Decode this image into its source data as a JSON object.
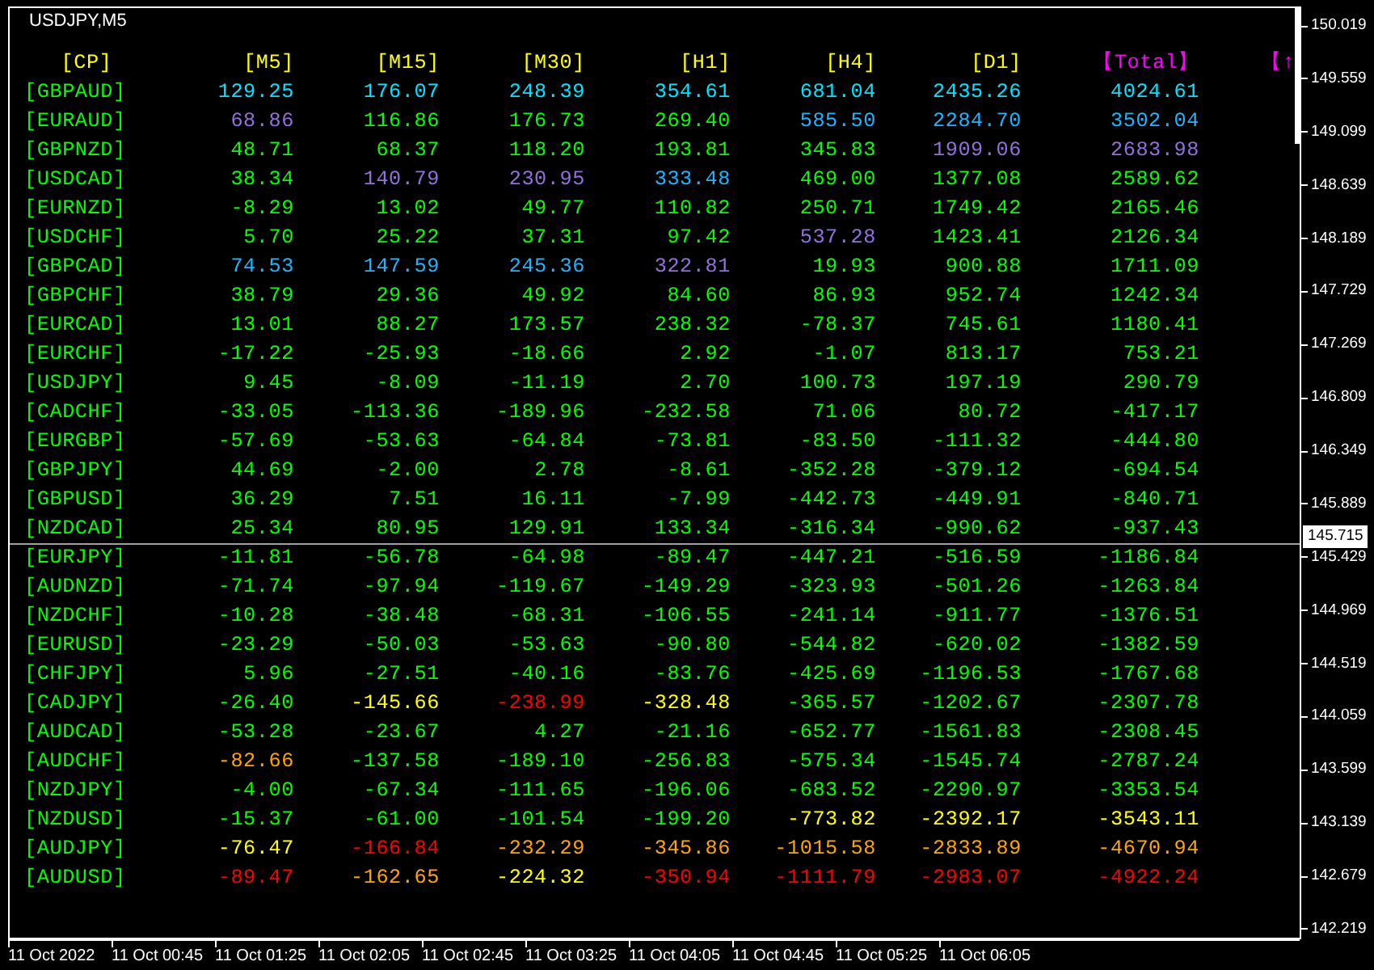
{
  "chart": {
    "title": "USDJPY,M5",
    "columns": [
      {
        "label": "[CP]",
        "color": "#ffff00"
      },
      {
        "label": "[M5]",
        "color": "#ffff00"
      },
      {
        "label": "[M15]",
        "color": "#ffff00"
      },
      {
        "label": "[M30]",
        "color": "#ffff00"
      },
      {
        "label": "[H1]",
        "color": "#ffff00"
      },
      {
        "label": "[H4]",
        "color": "#ffff00"
      },
      {
        "label": "[D1]",
        "color": "#ffff00"
      },
      {
        "label": "【Total】",
        "color": "#ff00ff"
      },
      {
        "label": "【↑",
        "color": "#ff00ff"
      }
    ],
    "rows": [
      {
        "cells": [
          {
            "value": "[GBPAUD]",
            "color": "#00ff00"
          },
          {
            "value": "129.25",
            "color": "#00e5ff"
          },
          {
            "value": "176.07",
            "color": "#00e5ff"
          },
          {
            "value": "248.39",
            "color": "#00e5ff"
          },
          {
            "value": "354.61",
            "color": "#00e5ff"
          },
          {
            "value": "681.04",
            "color": "#00e5ff"
          },
          {
            "value": "2435.26",
            "color": "#00e5ff"
          },
          {
            "value": "4024.61",
            "color": "#00e5ff"
          }
        ]
      },
      {
        "cells": [
          {
            "value": "[EURAUD]",
            "color": "#00ff00"
          },
          {
            "value": "68.86",
            "color": "#9370db"
          },
          {
            "value": "116.86",
            "color": "#00ff00"
          },
          {
            "value": "176.73",
            "color": "#00ff00"
          },
          {
            "value": "269.40",
            "color": "#00ff00"
          },
          {
            "value": "585.50",
            "color": "#1eb4ff"
          },
          {
            "value": "2284.70",
            "color": "#1eb4ff"
          },
          {
            "value": "3502.04",
            "color": "#1eb4ff"
          }
        ]
      },
      {
        "cells": [
          {
            "value": "[GBPNZD]",
            "color": "#00ff00"
          },
          {
            "value": "48.71",
            "color": "#00ff00"
          },
          {
            "value": "68.37",
            "color": "#00ff00"
          },
          {
            "value": "118.20",
            "color": "#00ff00"
          },
          {
            "value": "193.81",
            "color": "#00ff00"
          },
          {
            "value": "345.83",
            "color": "#00ff00"
          },
          {
            "value": "1909.06",
            "color": "#9370db"
          },
          {
            "value": "2683.98",
            "color": "#9370db"
          }
        ]
      },
      {
        "cells": [
          {
            "value": "[USDCAD]",
            "color": "#00ff00"
          },
          {
            "value": "38.34",
            "color": "#00ff00"
          },
          {
            "value": "140.79",
            "color": "#9370db"
          },
          {
            "value": "230.95",
            "color": "#9370db"
          },
          {
            "value": "333.48",
            "color": "#1eb4ff"
          },
          {
            "value": "469.00",
            "color": "#00ff00"
          },
          {
            "value": "1377.08",
            "color": "#00ff00"
          },
          {
            "value": "2589.62",
            "color": "#00ff00"
          }
        ]
      },
      {
        "cells": [
          {
            "value": "[EURNZD]",
            "color": "#00ff00"
          },
          {
            "value": "-8.29",
            "color": "#00ff00"
          },
          {
            "value": "13.02",
            "color": "#00ff00"
          },
          {
            "value": "49.77",
            "color": "#00ff00"
          },
          {
            "value": "110.82",
            "color": "#00ff00"
          },
          {
            "value": "250.71",
            "color": "#00ff00"
          },
          {
            "value": "1749.42",
            "color": "#00ff00"
          },
          {
            "value": "2165.46",
            "color": "#00ff00"
          }
        ]
      },
      {
        "cells": [
          {
            "value": "[USDCHF]",
            "color": "#00ff00"
          },
          {
            "value": "5.70",
            "color": "#00ff00"
          },
          {
            "value": "25.22",
            "color": "#00ff00"
          },
          {
            "value": "37.31",
            "color": "#00ff00"
          },
          {
            "value": "97.42",
            "color": "#00ff00"
          },
          {
            "value": "537.28",
            "color": "#9370db"
          },
          {
            "value": "1423.41",
            "color": "#00ff00"
          },
          {
            "value": "2126.34",
            "color": "#00ff00"
          }
        ]
      },
      {
        "cells": [
          {
            "value": "[GBPCAD]",
            "color": "#00ff00"
          },
          {
            "value": "74.53",
            "color": "#1eb4ff"
          },
          {
            "value": "147.59",
            "color": "#1eb4ff"
          },
          {
            "value": "245.36",
            "color": "#1eb4ff"
          },
          {
            "value": "322.81",
            "color": "#9370db"
          },
          {
            "value": "19.93",
            "color": "#00ff00"
          },
          {
            "value": "900.88",
            "color": "#00ff00"
          },
          {
            "value": "1711.09",
            "color": "#00ff00"
          }
        ]
      },
      {
        "cells": [
          {
            "value": "[GBPCHF]",
            "color": "#00ff00"
          },
          {
            "value": "38.79",
            "color": "#00ff00"
          },
          {
            "value": "29.36",
            "color": "#00ff00"
          },
          {
            "value": "49.92",
            "color": "#00ff00"
          },
          {
            "value": "84.60",
            "color": "#00ff00"
          },
          {
            "value": "86.93",
            "color": "#00ff00"
          },
          {
            "value": "952.74",
            "color": "#00ff00"
          },
          {
            "value": "1242.34",
            "color": "#00ff00"
          }
        ]
      },
      {
        "cells": [
          {
            "value": "[EURCAD]",
            "color": "#00ff00"
          },
          {
            "value": "13.01",
            "color": "#00ff00"
          },
          {
            "value": "88.27",
            "color": "#00ff00"
          },
          {
            "value": "173.57",
            "color": "#00ff00"
          },
          {
            "value": "238.32",
            "color": "#00ff00"
          },
          {
            "value": "-78.37",
            "color": "#00ff00"
          },
          {
            "value": "745.61",
            "color": "#00ff00"
          },
          {
            "value": "1180.41",
            "color": "#00ff00"
          }
        ]
      },
      {
        "cells": [
          {
            "value": "[EURCHF]",
            "color": "#00ff00"
          },
          {
            "value": "-17.22",
            "color": "#00ff00"
          },
          {
            "value": "-25.93",
            "color": "#00ff00"
          },
          {
            "value": "-18.66",
            "color": "#00ff00"
          },
          {
            "value": "2.92",
            "color": "#00ff00"
          },
          {
            "value": "-1.07",
            "color": "#00ff00"
          },
          {
            "value": "813.17",
            "color": "#00ff00"
          },
          {
            "value": "753.21",
            "color": "#00ff00"
          }
        ]
      },
      {
        "cells": [
          {
            "value": "[USDJPY]",
            "color": "#00ff00"
          },
          {
            "value": "9.45",
            "color": "#00ff00"
          },
          {
            "value": "-8.09",
            "color": "#00ff00"
          },
          {
            "value": "-11.19",
            "color": "#00ff00"
          },
          {
            "value": "2.70",
            "color": "#00ff00"
          },
          {
            "value": "100.73",
            "color": "#00ff00"
          },
          {
            "value": "197.19",
            "color": "#00ff00"
          },
          {
            "value": "290.79",
            "color": "#00ff00"
          }
        ]
      },
      {
        "cells": [
          {
            "value": "[CADCHF]",
            "color": "#00ff00"
          },
          {
            "value": "-33.05",
            "color": "#00ff00"
          },
          {
            "value": "-113.36",
            "color": "#00ff00"
          },
          {
            "value": "-189.96",
            "color": "#00ff00"
          },
          {
            "value": "-232.58",
            "color": "#00ff00"
          },
          {
            "value": "71.06",
            "color": "#00ff00"
          },
          {
            "value": "80.72",
            "color": "#00ff00"
          },
          {
            "value": "-417.17",
            "color": "#00ff00"
          }
        ]
      },
      {
        "cells": [
          {
            "value": "[EURGBP]",
            "color": "#00ff00"
          },
          {
            "value": "-57.69",
            "color": "#00ff00"
          },
          {
            "value": "-53.63",
            "color": "#00ff00"
          },
          {
            "value": "-64.84",
            "color": "#00ff00"
          },
          {
            "value": "-73.81",
            "color": "#00ff00"
          },
          {
            "value": "-83.50",
            "color": "#00ff00"
          },
          {
            "value": "-111.32",
            "color": "#00ff00"
          },
          {
            "value": "-444.80",
            "color": "#00ff00"
          }
        ]
      },
      {
        "cells": [
          {
            "value": "[GBPJPY]",
            "color": "#00ff00"
          },
          {
            "value": "44.69",
            "color": "#00ff00"
          },
          {
            "value": "-2.00",
            "color": "#00ff00"
          },
          {
            "value": "2.78",
            "color": "#00ff00"
          },
          {
            "value": "-8.61",
            "color": "#00ff00"
          },
          {
            "value": "-352.28",
            "color": "#00ff00"
          },
          {
            "value": "-379.12",
            "color": "#00ff00"
          },
          {
            "value": "-694.54",
            "color": "#00ff00"
          }
        ]
      },
      {
        "cells": [
          {
            "value": "[GBPUSD]",
            "color": "#00ff00"
          },
          {
            "value": "36.29",
            "color": "#00ff00"
          },
          {
            "value": "7.51",
            "color": "#00ff00"
          },
          {
            "value": "16.11",
            "color": "#00ff00"
          },
          {
            "value": "-7.99",
            "color": "#00ff00"
          },
          {
            "value": "-442.73",
            "color": "#00ff00"
          },
          {
            "value": "-449.91",
            "color": "#00ff00"
          },
          {
            "value": "-840.71",
            "color": "#00ff00"
          }
        ]
      },
      {
        "cells": [
          {
            "value": "[NZDCAD]",
            "color": "#00ff00"
          },
          {
            "value": "25.34",
            "color": "#00ff00"
          },
          {
            "value": "80.95",
            "color": "#00ff00"
          },
          {
            "value": "129.91",
            "color": "#00ff00"
          },
          {
            "value": "133.34",
            "color": "#00ff00"
          },
          {
            "value": "-316.34",
            "color": "#00ff00"
          },
          {
            "value": "-990.62",
            "color": "#00ff00"
          },
          {
            "value": "-937.43",
            "color": "#00ff00"
          }
        ]
      },
      {
        "cells": [
          {
            "value": "[EURJPY]",
            "color": "#00ff00"
          },
          {
            "value": "-11.81",
            "color": "#00ff00"
          },
          {
            "value": "-56.78",
            "color": "#00ff00"
          },
          {
            "value": "-64.98",
            "color": "#00ff00"
          },
          {
            "value": "-89.47",
            "color": "#00ff00"
          },
          {
            "value": "-447.21",
            "color": "#00ff00"
          },
          {
            "value": "-516.59",
            "color": "#00ff00"
          },
          {
            "value": "-1186.84",
            "color": "#00ff00"
          }
        ]
      },
      {
        "cells": [
          {
            "value": "[AUDNZD]",
            "color": "#00ff00"
          },
          {
            "value": "-71.74",
            "color": "#00ff00"
          },
          {
            "value": "-97.94",
            "color": "#00ff00"
          },
          {
            "value": "-119.67",
            "color": "#00ff00"
          },
          {
            "value": "-149.29",
            "color": "#00ff00"
          },
          {
            "value": "-323.93",
            "color": "#00ff00"
          },
          {
            "value": "-501.26",
            "color": "#00ff00"
          },
          {
            "value": "-1263.84",
            "color": "#00ff00"
          }
        ]
      },
      {
        "cells": [
          {
            "value": "[NZDCHF]",
            "color": "#00ff00"
          },
          {
            "value": "-10.28",
            "color": "#00ff00"
          },
          {
            "value": "-38.48",
            "color": "#00ff00"
          },
          {
            "value": "-68.31",
            "color": "#00ff00"
          },
          {
            "value": "-106.55",
            "color": "#00ff00"
          },
          {
            "value": "-241.14",
            "color": "#00ff00"
          },
          {
            "value": "-911.77",
            "color": "#00ff00"
          },
          {
            "value": "-1376.51",
            "color": "#00ff00"
          }
        ]
      },
      {
        "cells": [
          {
            "value": "[EURUSD]",
            "color": "#00ff00"
          },
          {
            "value": "-23.29",
            "color": "#00ff00"
          },
          {
            "value": "-50.03",
            "color": "#00ff00"
          },
          {
            "value": "-53.63",
            "color": "#00ff00"
          },
          {
            "value": "-90.80",
            "color": "#00ff00"
          },
          {
            "value": "-544.82",
            "color": "#00ff00"
          },
          {
            "value": "-620.02",
            "color": "#00ff00"
          },
          {
            "value": "-1382.59",
            "color": "#00ff00"
          }
        ]
      },
      {
        "cells": [
          {
            "value": "[CHFJPY]",
            "color": "#00ff00"
          },
          {
            "value": "5.96",
            "color": "#00ff00"
          },
          {
            "value": "-27.51",
            "color": "#00ff00"
          },
          {
            "value": "-40.16",
            "color": "#00ff00"
          },
          {
            "value": "-83.76",
            "color": "#00ff00"
          },
          {
            "value": "-425.69",
            "color": "#00ff00"
          },
          {
            "value": "-1196.53",
            "color": "#00ff00"
          },
          {
            "value": "-1767.68",
            "color": "#00ff00"
          }
        ]
      },
      {
        "cells": [
          {
            "value": "[CADJPY]",
            "color": "#00ff00"
          },
          {
            "value": "-26.40",
            "color": "#00ff00"
          },
          {
            "value": "-145.66",
            "color": "#ffff00"
          },
          {
            "value": "-238.99",
            "color": "#ff0000"
          },
          {
            "value": "-328.48",
            "color": "#ffff00"
          },
          {
            "value": "-365.57",
            "color": "#00ff00"
          },
          {
            "value": "-1202.67",
            "color": "#00ff00"
          },
          {
            "value": "-2307.78",
            "color": "#00ff00"
          }
        ]
      },
      {
        "cells": [
          {
            "value": "[AUDCAD]",
            "color": "#00ff00"
          },
          {
            "value": "-53.28",
            "color": "#00ff00"
          },
          {
            "value": "-23.67",
            "color": "#00ff00"
          },
          {
            "value": "4.27",
            "color": "#00ff00"
          },
          {
            "value": "-21.16",
            "color": "#00ff00"
          },
          {
            "value": "-652.77",
            "color": "#00ff00"
          },
          {
            "value": "-1561.83",
            "color": "#00ff00"
          },
          {
            "value": "-2308.45",
            "color": "#00ff00"
          }
        ]
      },
      {
        "cells": [
          {
            "value": "[AUDCHF]",
            "color": "#00ff00"
          },
          {
            "value": "-82.66",
            "color": "#ffa500"
          },
          {
            "value": "-137.58",
            "color": "#00ff00"
          },
          {
            "value": "-189.10",
            "color": "#00ff00"
          },
          {
            "value": "-256.83",
            "color": "#00ff00"
          },
          {
            "value": "-575.34",
            "color": "#00ff00"
          },
          {
            "value": "-1545.74",
            "color": "#00ff00"
          },
          {
            "value": "-2787.24",
            "color": "#00ff00"
          }
        ]
      },
      {
        "cells": [
          {
            "value": "[NZDJPY]",
            "color": "#00ff00"
          },
          {
            "value": "-4.00",
            "color": "#00ff00"
          },
          {
            "value": "-67.34",
            "color": "#00ff00"
          },
          {
            "value": "-111.65",
            "color": "#00ff00"
          },
          {
            "value": "-196.06",
            "color": "#00ff00"
          },
          {
            "value": "-683.52",
            "color": "#00ff00"
          },
          {
            "value": "-2290.97",
            "color": "#00ff00"
          },
          {
            "value": "-3353.54",
            "color": "#00ff00"
          }
        ]
      },
      {
        "cells": [
          {
            "value": "[NZDUSD]",
            "color": "#00ff00"
          },
          {
            "value": "-15.37",
            "color": "#00ff00"
          },
          {
            "value": "-61.00",
            "color": "#00ff00"
          },
          {
            "value": "-101.54",
            "color": "#00ff00"
          },
          {
            "value": "-199.20",
            "color": "#00ff00"
          },
          {
            "value": "-773.82",
            "color": "#ffff00"
          },
          {
            "value": "-2392.17",
            "color": "#ffff00"
          },
          {
            "value": "-3543.11",
            "color": "#ffff00"
          }
        ]
      },
      {
        "cells": [
          {
            "value": "[AUDJPY]",
            "color": "#00ff00"
          },
          {
            "value": "-76.47",
            "color": "#ffff00"
          },
          {
            "value": "-166.84",
            "color": "#ff0000"
          },
          {
            "value": "-232.29",
            "color": "#ffa500"
          },
          {
            "value": "-345.86",
            "color": "#ffa500"
          },
          {
            "value": "-1015.58",
            "color": "#ffa500"
          },
          {
            "value": "-2833.89",
            "color": "#ffa500"
          },
          {
            "value": "-4670.94",
            "color": "#ffa500"
          }
        ]
      },
      {
        "cells": [
          {
            "value": "[AUDUSD]",
            "color": "#00ff00"
          },
          {
            "value": "-89.47",
            "color": "#ff0000"
          },
          {
            "value": "-162.65",
            "color": "#ffa500"
          },
          {
            "value": "-224.32",
            "color": "#ffff00"
          },
          {
            "value": "-350.94",
            "color": "#ff0000"
          },
          {
            "value": "-1111.79",
            "color": "#ff0000"
          },
          {
            "value": "-2983.07",
            "color": "#ff0000"
          },
          {
            "value": "-4922.24",
            "color": "#ff0000"
          }
        ]
      }
    ],
    "current_price": "145.715",
    "price_axis": [
      "150.019",
      "149.559",
      "149.099",
      "148.639",
      "148.189",
      "147.729",
      "147.269",
      "146.809",
      "146.349",
      "145.889",
      "145.429",
      "144.969",
      "144.519",
      "144.059",
      "143.599",
      "143.139",
      "142.679",
      "142.219"
    ],
    "time_axis": [
      "11 Oct 2022",
      "11 Oct 00:45",
      "11 Oct 01:25",
      "11 Oct 02:05",
      "11 Oct 02:45",
      "11 Oct 03:25",
      "11 Oct 04:05",
      "11 Oct 04:45",
      "11 Oct 05:25",
      "11 Oct 06:05"
    ]
  }
}
